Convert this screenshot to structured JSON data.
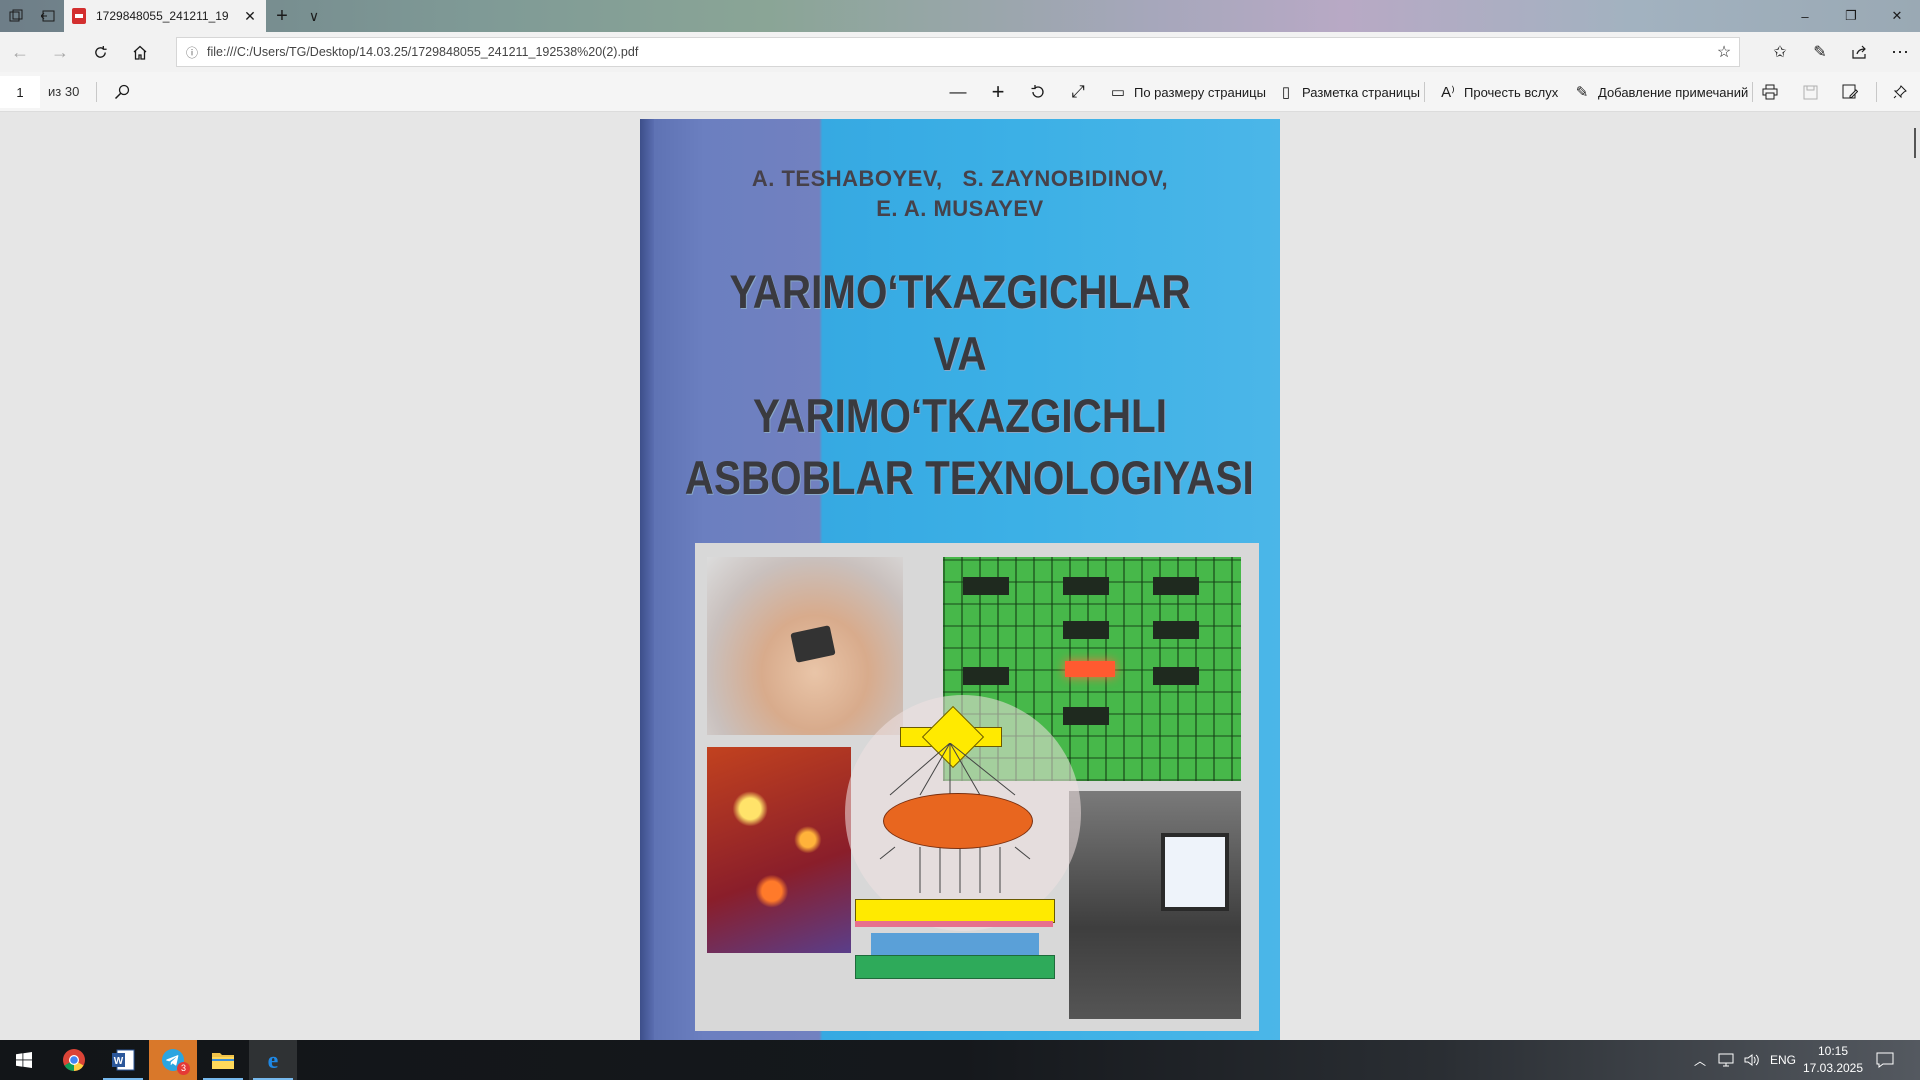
{
  "titlebar": {
    "tab_title": "1729848055_241211_19",
    "new_tab_symbol": "+",
    "tab_list_symbol": "∨",
    "minimize_symbol": "–",
    "restore_symbol": "❐",
    "close_symbol": "✕"
  },
  "navbar": {
    "url": "file:///C:/Users/TG/Desktop/14.03.25/1729848055_241211_192538%20(2).pdf"
  },
  "pdf_toolbar": {
    "page_number": "1",
    "page_total": "из 30",
    "fit_page_label": "По размеру страницы",
    "page_layout_label": "Разметка страницы",
    "read_aloud_label": "Прочесть вслух",
    "add_notes_label": "Добавление примечаний"
  },
  "document": {
    "authors_line1": "A. TESHABOYEV,   S. ZAYNOBIDINOV,",
    "authors_line2": "E. A. MUSAYEV",
    "title_line1": "YARIMO‘TKAZGICHLAR",
    "title_line2": "VA",
    "title_line3": "YARIMO‘TKAZGICHLI",
    "title_line4": "ASBOBLAR  TEXNOLOGIYASI"
  },
  "taskbar": {
    "telegram_badge": "3",
    "language": "ENG",
    "time": "10:15",
    "date": "17.03.2025"
  },
  "colors": {
    "cover_left": "#6b7fc0",
    "cover_right": "#3cb0e6",
    "chip_yellow": "#ffea00",
    "circuit_green": "#47b84a",
    "taskbar_accent": "#76b9ed"
  }
}
